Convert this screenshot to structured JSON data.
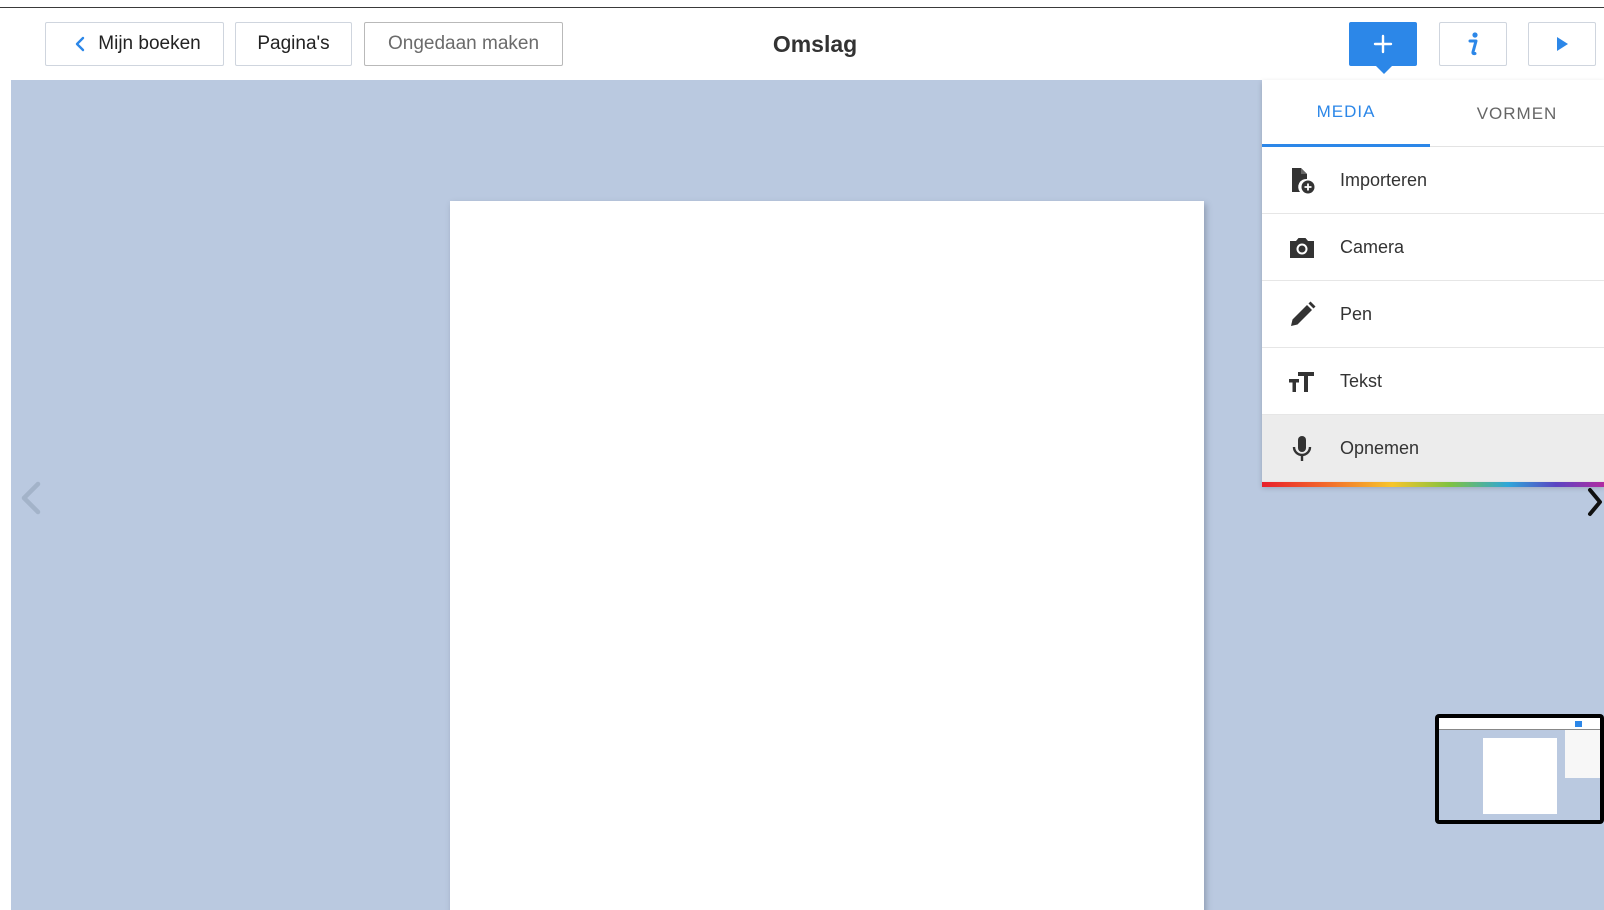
{
  "toolbar": {
    "back_label": "Mijn boeken",
    "pages_label": "Pagina's",
    "undo_label": "Ongedaan maken",
    "title": "Omslag",
    "add_symbol": "+",
    "info_symbol": "i"
  },
  "menu": {
    "tabs": [
      {
        "label": "MEDIA",
        "active": true
      },
      {
        "label": "VORMEN",
        "active": false
      }
    ],
    "items": [
      {
        "label": "Importeren",
        "icon": "import-file-icon"
      },
      {
        "label": "Camera",
        "icon": "camera-icon"
      },
      {
        "label": "Pen",
        "icon": "pen-icon"
      },
      {
        "label": "Tekst",
        "icon": "text-size-icon"
      },
      {
        "label": "Opnemen",
        "icon": "microphone-icon",
        "active": true
      }
    ]
  },
  "colors": {
    "accent": "#2c87e8",
    "canvas_background": "#bac9e0",
    "page": "#ffffff"
  }
}
